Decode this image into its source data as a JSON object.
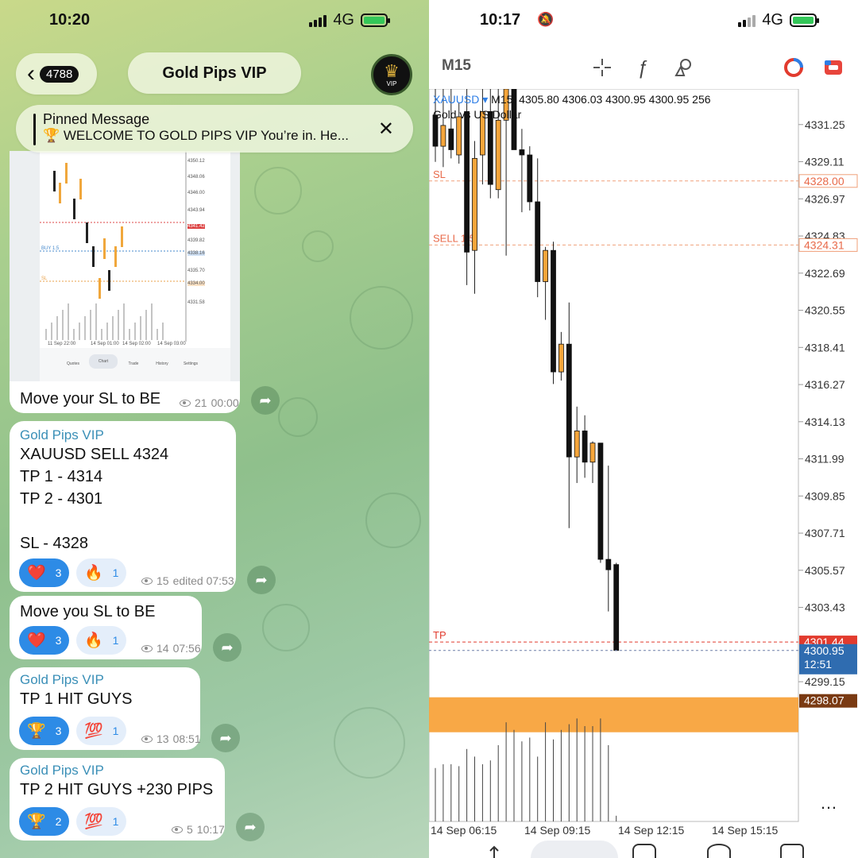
{
  "left_status": {
    "time": "10:20",
    "network": "4G"
  },
  "header": {
    "back_count": "4788",
    "title": "Gold Pips VIP",
    "avatar_text": "VIP"
  },
  "pinned": {
    "label": "Pinned Message",
    "text": "🏆 WELCOME TO GOLD PIPS VIP You’re in. He..."
  },
  "mini_chart": {
    "price_labels": [
      "4350.12",
      "4348.06",
      "4346.00",
      "4343.94",
      "4341.42",
      "4339.82",
      "4338.16",
      "4335.70",
      "4334.00",
      "4331.58"
    ],
    "line_labels": [
      "BUY 1.5",
      "SL"
    ],
    "time_labels": [
      "11 Sep 22:00",
      "14 Sep 01:00",
      "14 Sep 02:00",
      "14 Sep 03:00"
    ],
    "tabs": [
      "Quotes",
      "Chart",
      "Trade",
      "History",
      "Settings"
    ]
  },
  "messages": [
    {
      "sender": "",
      "text": "Move your SL to BE",
      "views": "21",
      "time": "00:00",
      "reactions": []
    },
    {
      "sender": "Gold Pips VIP",
      "text": "XAUUSD SELL 4324\nTP 1 - 4314\nTP 2 - 4301\n\nSL - 4328",
      "views": "15",
      "time": "edited 07:53",
      "reactions": [
        {
          "emoji": "❤️",
          "count": "3"
        },
        {
          "emoji": "🔥",
          "count": "1"
        }
      ]
    },
    {
      "sender": "",
      "text": "Move you SL to BE",
      "views": "14",
      "time": "07:56",
      "reactions": [
        {
          "emoji": "❤️",
          "count": "3"
        },
        {
          "emoji": "🔥",
          "count": "1"
        }
      ]
    },
    {
      "sender": "Gold Pips VIP",
      "text": "TP 1 HIT GUYS",
      "views": "13",
      "time": "08:51",
      "reactions": [
        {
          "emoji": "🏆",
          "count": "3"
        },
        {
          "emoji": "💯",
          "count": "1"
        }
      ]
    },
    {
      "sender": "Gold Pips VIP",
      "text": "TP 2 HIT GUYS +230 PIPS",
      "views": "5",
      "time": "10:17",
      "reactions": [
        {
          "emoji": "🏆",
          "count": "2"
        },
        {
          "emoji": "💯",
          "count": "1"
        }
      ]
    }
  ],
  "right_status": {
    "time": "10:17",
    "network": "4G"
  },
  "toolbar": {
    "timeframe": "M15",
    "crosshair": "-¦-",
    "fx": "ƒ",
    "objects": "⌂"
  },
  "chart_data": {
    "type": "candlestick",
    "symbol": "XAUUSD",
    "timeframe": "M15",
    "header_values": "4305.80 4306.03 4300.95 4300.95 256",
    "description": "Gold vs US Dollar",
    "price_ticks": [
      "4331.25",
      "4329.11",
      "4326.97",
      "4324.83",
      "4322.69",
      "4320.55",
      "4318.41",
      "4316.27",
      "4314.13",
      "4311.99",
      "4309.85",
      "4307.71",
      "4305.57",
      "4303.43",
      "4299.15"
    ],
    "ylim": [
      4296.5,
      4333.3
    ],
    "time_ticks": [
      "14 Sep 06:15",
      "14 Sep 09:15",
      "14 Sep 12:15",
      "14 Sep 15:15"
    ],
    "levels": [
      {
        "name": "SL",
        "value": 4328.0,
        "label": "4328.00"
      },
      {
        "name": "SELL 1.5",
        "value": 4324.31,
        "label": "4324.31"
      },
      {
        "name": "TP",
        "value": 4301.44,
        "label": "4301.44"
      }
    ],
    "bid": {
      "value": 4300.95,
      "label": "4300.95",
      "countdown": "12:51"
    },
    "low_marker": {
      "value": 4298.07,
      "label": "4298.07"
    },
    "candles": [
      {
        "o": 4331.8,
        "h": 4334.5,
        "l": 4329.1,
        "c": 4330.0
      },
      {
        "o": 4330.0,
        "h": 4334.5,
        "l": 4328.8,
        "c": 4331.2
      },
      {
        "o": 4331.0,
        "h": 4334.0,
        "l": 4329.3,
        "c": 4329.8
      },
      {
        "o": 4329.5,
        "h": 4332.5,
        "l": 4329.0,
        "c": 4331.7
      },
      {
        "o": 4332.0,
        "h": 4334.5,
        "l": 4322.0,
        "c": 4323.9
      },
      {
        "o": 4324.0,
        "h": 4330.3,
        "l": 4321.5,
        "c": 4329.3
      },
      {
        "o": 4329.5,
        "h": 4334.0,
        "l": 4327.8,
        "c": 4332.0
      },
      {
        "o": 4332.0,
        "h": 4334.5,
        "l": 4327.0,
        "c": 4327.8
      },
      {
        "o": 4327.5,
        "h": 4333.5,
        "l": 4327.0,
        "c": 4331.5
      },
      {
        "o": 4331.5,
        "h": 4334.5,
        "l": 4323.7,
        "c": 4333.5
      },
      {
        "o": 4333.5,
        "h": 4334.5,
        "l": 4329.8,
        "c": 4329.8
      },
      {
        "o": 4329.8,
        "h": 4331.0,
        "l": 4326.2,
        "c": 4329.5
      },
      {
        "o": 4329.5,
        "h": 4330.0,
        "l": 4326.3,
        "c": 4326.8
      },
      {
        "o": 4326.8,
        "h": 4329.3,
        "l": 4321.3,
        "c": 4322.2
      },
      {
        "o": 4322.2,
        "h": 4324.2,
        "l": 4320.0,
        "c": 4324.0
      },
      {
        "o": 4324.0,
        "h": 4324.5,
        "l": 4316.3,
        "c": 4317.0
      },
      {
        "o": 4317.0,
        "h": 4319.3,
        "l": 4316.5,
        "c": 4318.6
      },
      {
        "o": 4318.6,
        "h": 4321.0,
        "l": 4308.0,
        "c": 4312.1
      },
      {
        "o": 4312.1,
        "h": 4315.0,
        "l": 4310.6,
        "c": 4313.6
      },
      {
        "o": 4313.6,
        "h": 4314.5,
        "l": 4310.9,
        "c": 4311.8
      },
      {
        "o": 4311.8,
        "h": 4313.0,
        "l": 4310.6,
        "c": 4312.9
      },
      {
        "o": 4312.9,
        "h": 4312.9,
        "l": 4306.0,
        "c": 4306.2
      },
      {
        "o": 4306.2,
        "h": 4311.6,
        "l": 4303.2,
        "c": 4305.6
      },
      {
        "o": 4305.9,
        "h": 4306.0,
        "l": 4300.95,
        "c": 4300.95
      }
    ],
    "volume": [
      140,
      150,
      150,
      145,
      190,
      170,
      150,
      160,
      200,
      260,
      240,
      210,
      220,
      170,
      260,
      215,
      240,
      255,
      270,
      250,
      250,
      270,
      200,
      15
    ]
  }
}
